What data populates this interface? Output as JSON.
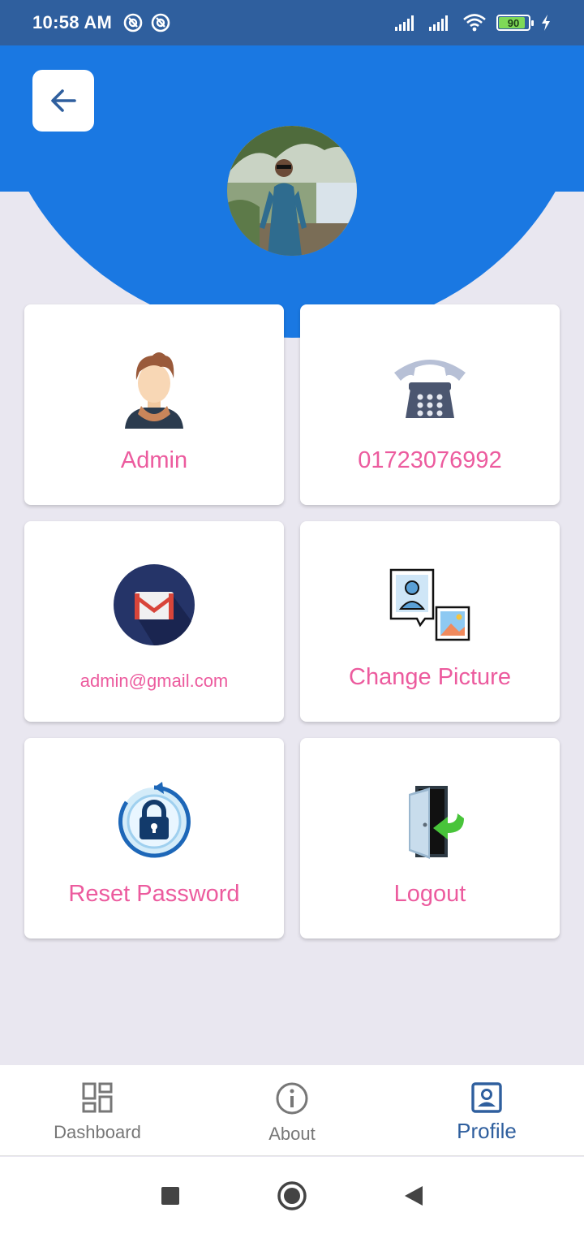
{
  "status_bar": {
    "time": "10:58 AM",
    "battery_level": "90",
    "battery_fraction": 0.9
  },
  "header": {
    "back_icon": "arrow-left-icon",
    "accent_color": "#1a78e2"
  },
  "cards": [
    {
      "label": "Admin",
      "icon": "user-avatar-icon"
    },
    {
      "label": "01723076992",
      "icon": "telephone-icon"
    },
    {
      "label": "admin@gmail.com",
      "icon": "gmail-icon"
    },
    {
      "label": "Change Picture",
      "icon": "change-picture-icon"
    },
    {
      "label": "Reset Password",
      "icon": "lock-reset-icon"
    },
    {
      "label": "Logout",
      "icon": "logout-door-icon"
    }
  ],
  "bottom_nav": {
    "items": [
      {
        "label": "Dashboard",
        "icon": "dashboard-icon",
        "active": false
      },
      {
        "label": "About",
        "icon": "info-icon",
        "active": false
      },
      {
        "label": "Profile",
        "icon": "profile-icon",
        "active": true
      }
    ]
  },
  "colors": {
    "status_bar": "#2f5f9e",
    "card_text": "#ec5b9e",
    "background": "#e9e7f0",
    "active_nav": "#2f5f9e"
  }
}
